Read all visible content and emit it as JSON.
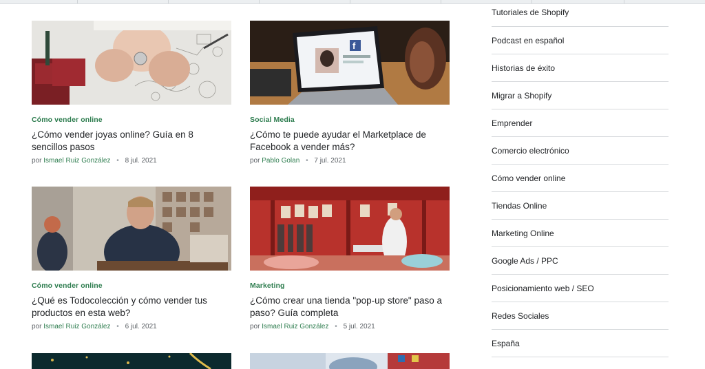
{
  "articles": [
    {
      "category": "Cómo vender online",
      "title": "¿Cómo vender joyas online? Guía en 8 sencillos pasos",
      "by": "por",
      "author": "Ismael Ruiz González",
      "date": "8 jul. 2021"
    },
    {
      "category": "Social Media",
      "title": "¿Cómo te puede ayudar el Marketplace de Facebook a vender más?",
      "by": "por",
      "author": "Pablo Golan",
      "date": "7 jul. 2021"
    },
    {
      "category": "Cómo vender online",
      "title": "¿Qué es Todocolección y cómo vender tus productos en esta web?",
      "by": "por",
      "author": "Ismael Ruiz González",
      "date": "6 jul. 2021"
    },
    {
      "category": "Marketing",
      "title": "¿Cómo crear una tienda \"pop-up store\" paso a paso? Guía completa",
      "by": "por",
      "author": "Ismael Ruiz González",
      "date": "5 jul. 2021"
    }
  ],
  "sidebar": {
    "items": [
      "Tutoriales de Shopify",
      "Podcast en español",
      "Historias de éxito",
      "Migrar a Shopify",
      "Emprender",
      "Comercio electrónico",
      "Cómo vender online",
      "Tiendas Online",
      "Marketing Online",
      "Google Ads / PPC",
      "Posicionamiento web / SEO",
      "Redes Sociales",
      "España"
    ]
  },
  "colors": {
    "accent": "#2e7d4f",
    "text": "#212326",
    "muted": "#5c6166",
    "divider": "#d6d9dc"
  }
}
